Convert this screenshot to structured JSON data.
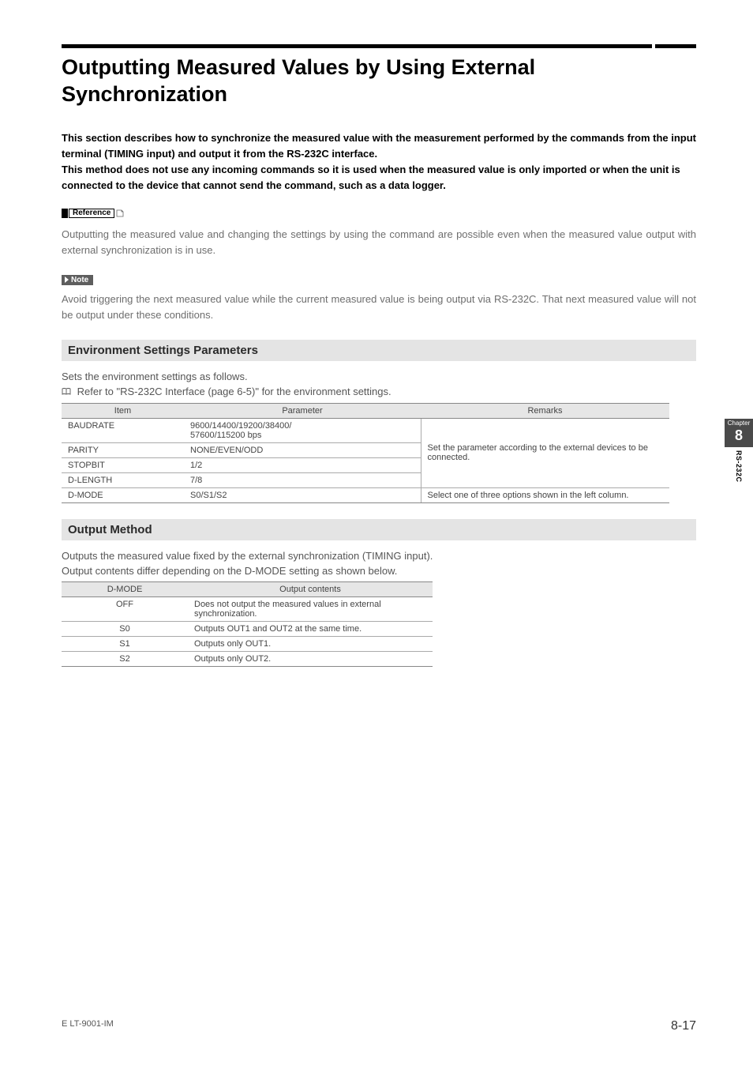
{
  "title": "Outputting Measured Values by Using External Synchronization",
  "intro": "This section describes how to synchronize the measured value with the measurement performed by the commands from the input terminal (TIMING input) and output it from the RS-232C interface.\nThis method does not use any incoming commands so it is used when the measured value is only imported or when the unit is connected to the device that cannot send the command, such as a data logger.",
  "reference_label": "Reference",
  "reference_text": "Outputting the measured value and changing the settings by using the command are possible even when the measured value output with external synchronization is in use.",
  "note_label": "Note",
  "note_text": "Avoid triggering the next measured value while the current measured value is being output via RS-232C. That next measured value will not be output under these conditions.",
  "section1": {
    "heading": "Environment Settings Parameters",
    "line1": "Sets the environment settings as follows.",
    "line2": "Refer to \"RS-232C Interface (page 6-5)\" for the environment settings.",
    "headers": {
      "item": "Item",
      "param": "Parameter",
      "remarks": "Remarks"
    },
    "rows": [
      {
        "item": "BAUDRATE",
        "param": "9600/14400/19200/38400/\n57600/115200 bps"
      },
      {
        "item": "PARITY",
        "param": "NONE/EVEN/ODD"
      },
      {
        "item": "STOPBIT",
        "param": "1/2"
      },
      {
        "item": "D-LENGTH",
        "param": "7/8"
      },
      {
        "item": "D-MODE",
        "param": "S0/S1/S2"
      }
    ],
    "remarks_group": "Set the parameter according to the external devices to be connected.",
    "remarks_dmode": "Select one of three options shown in the left column."
  },
  "section2": {
    "heading": "Output Method",
    "line1": "Outputs the measured value fixed by the external synchronization (TIMING input).",
    "line2": "Output contents differ depending on the D-MODE setting as shown below.",
    "headers": {
      "mode": "D-MODE",
      "contents": "Output contents"
    },
    "rows": [
      {
        "mode": "OFF",
        "contents": "Does not output the measured values in external synchronization."
      },
      {
        "mode": "S0",
        "contents": "Outputs OUT1 and OUT2 at the same time."
      },
      {
        "mode": "S1",
        "contents": "Outputs only OUT1."
      },
      {
        "mode": "S2",
        "contents": "Outputs only OUT2."
      }
    ]
  },
  "sidetab": {
    "chapter_label": "Chapter",
    "chapter_num": "8",
    "side_text": "RS-232C"
  },
  "footer": {
    "left": "E LT-9001-IM",
    "right": "8-17"
  }
}
